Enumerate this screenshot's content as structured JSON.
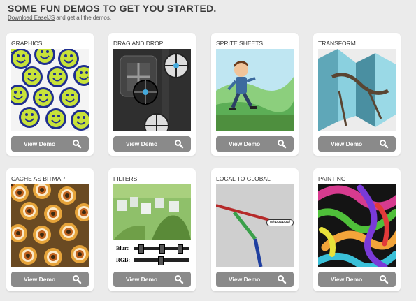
{
  "header": {
    "title": "SOME FUN DEMOS TO GET YOU STARTED.",
    "download_link": "Download EaselJS",
    "download_rest": " and get all the demos."
  },
  "demos": [
    {
      "title": "GRAPHICS",
      "button": "View Demo",
      "icon": "magnifier-icon"
    },
    {
      "title": "DRAG AND DROP",
      "button": "View Demo",
      "icon": "magnifier-icon"
    },
    {
      "title": "SPRITE SHEETS",
      "button": "View Demo",
      "icon": "magnifier-icon"
    },
    {
      "title": "TRANSFORM",
      "button": "View Demo",
      "icon": "magnifier-icon"
    },
    {
      "title": "CACHE AS BITMAP",
      "button": "View Demo",
      "icon": "magnifier-icon"
    },
    {
      "title": "FILTERS",
      "button": "View Demo",
      "icon": "magnifier-icon"
    },
    {
      "title": "LOCAL TO GLOBAL",
      "button": "View Demo",
      "icon": "magnifier-icon"
    },
    {
      "title": "PAINTING",
      "button": "View Demo",
      "icon": "magnifier-icon"
    }
  ],
  "filters_thumb": {
    "blur_label": "Blur:",
    "rgb_label": "RGB:"
  },
  "local_thumb": {
    "bubble_text": "wheeeeee!"
  },
  "colors": {
    "page_bg": "#ebebeb",
    "card_bg": "#ffffff",
    "button_bg": "#8a8a8a",
    "title_text": "#3a3a3a"
  }
}
